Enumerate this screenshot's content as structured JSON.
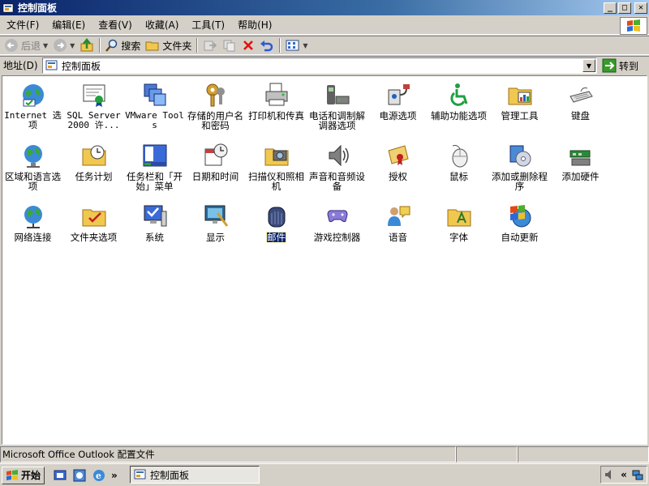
{
  "window": {
    "title": "控制面板",
    "title_icon": "control-panel-icon"
  },
  "title_buttons": {
    "minimize": "_",
    "maximize": "□",
    "close": "✕"
  },
  "menu": [
    "文件(F)",
    "编辑(E)",
    "查看(V)",
    "收藏(A)",
    "工具(T)",
    "帮助(H)"
  ],
  "toolbar": {
    "back_label": "后退",
    "search_label": "搜索",
    "folders_label": "文件夹"
  },
  "address": {
    "label": "地址(D)",
    "value": "控制面板",
    "go_label": "转到"
  },
  "items": [
    {
      "label": "Internet 选项",
      "icon": "internet-options-icon"
    },
    {
      "label": "SQL Server 2000 许...",
      "icon": "sql-server-license-icon"
    },
    {
      "label": "VMware Tools",
      "icon": "vmware-tools-icon"
    },
    {
      "label": "存储的用户名和密码",
      "icon": "stored-passwords-icon"
    },
    {
      "label": "打印机和传真",
      "icon": "printers-faxes-icon"
    },
    {
      "label": "电话和调制解调器选项",
      "icon": "phone-modem-icon"
    },
    {
      "label": "电源选项",
      "icon": "power-options-icon"
    },
    {
      "label": "辅助功能选项",
      "icon": "accessibility-icon"
    },
    {
      "label": "管理工具",
      "icon": "admin-tools-icon"
    },
    {
      "label": "键盘",
      "icon": "keyboard-icon"
    },
    {
      "label": "区域和语言选项",
      "icon": "regional-language-icon"
    },
    {
      "label": "任务计划",
      "icon": "scheduled-tasks-icon"
    },
    {
      "label": "任务栏和「开始」菜单",
      "icon": "taskbar-start-menu-icon"
    },
    {
      "label": "日期和时间",
      "icon": "date-time-icon"
    },
    {
      "label": "扫描仪和照相机",
      "icon": "scanners-cameras-icon"
    },
    {
      "label": "声音和音频设备",
      "icon": "sounds-audio-icon"
    },
    {
      "label": "授权",
      "icon": "licensing-icon"
    },
    {
      "label": "鼠标",
      "icon": "mouse-icon"
    },
    {
      "label": "添加或删除程序",
      "icon": "add-remove-programs-icon"
    },
    {
      "label": "添加硬件",
      "icon": "add-hardware-icon"
    },
    {
      "label": "网络连接",
      "icon": "network-connections-icon"
    },
    {
      "label": "文件夹选项",
      "icon": "folder-options-icon"
    },
    {
      "label": "系统",
      "icon": "system-icon"
    },
    {
      "label": "显示",
      "icon": "display-icon"
    },
    {
      "label": "邮件",
      "icon": "mail-icon",
      "selected": true
    },
    {
      "label": "游戏控制器",
      "icon": "game-controllers-icon"
    },
    {
      "label": "语音",
      "icon": "speech-icon"
    },
    {
      "label": "字体",
      "icon": "fonts-icon"
    },
    {
      "label": "自动更新",
      "icon": "automatic-updates-icon"
    }
  ],
  "status": {
    "text": "Microsoft Office Outlook 配置文件"
  },
  "taskbar": {
    "start_label": "开始",
    "task_label": "控制面板",
    "chevron": "»",
    "tray_chevron": "«"
  }
}
